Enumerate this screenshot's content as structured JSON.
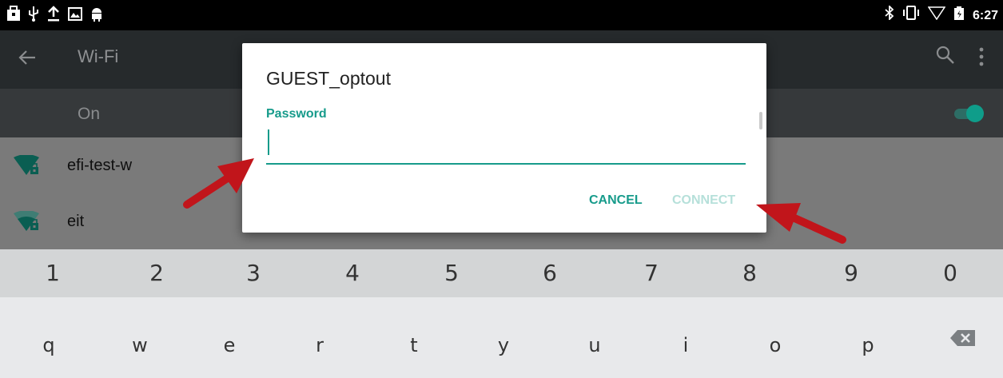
{
  "status_bar": {
    "left_icons": [
      "notification-bag-icon",
      "usb-icon",
      "upload-icon",
      "photo-icon",
      "android-icon"
    ],
    "right_icons": [
      "bluetooth-icon",
      "vibrate-icon",
      "wifi-signal-icon",
      "battery-icon"
    ],
    "time": "6:27"
  },
  "app_bar": {
    "title": "Wi-Fi",
    "back_icon": "arrow-back-icon",
    "search_icon": "search-icon",
    "overflow_icon": "more-vert-icon"
  },
  "toggle": {
    "label": "On",
    "state": "on"
  },
  "wifi_list": [
    {
      "ssid": "efi-test-w",
      "icon": "wifi-lock-icon"
    },
    {
      "ssid": "eit",
      "icon": "wifi-lock-icon"
    }
  ],
  "dialog": {
    "title": "GUEST_optout",
    "field_label": "Password",
    "password_value": "",
    "cancel_label": "CANCEL",
    "connect_label": "CONNECT"
  },
  "keyboard": {
    "row1": [
      "1",
      "2",
      "3",
      "4",
      "5",
      "6",
      "7",
      "8",
      "9",
      "0"
    ],
    "row2": [
      "q",
      "w",
      "e",
      "r",
      "t",
      "y",
      "u",
      "i",
      "o",
      "p"
    ],
    "backspace_icon": "backspace-icon"
  },
  "colors": {
    "accent": "#179b8b",
    "accent_disabled": "#b6e0da",
    "annotation_arrow": "#c1151b"
  }
}
